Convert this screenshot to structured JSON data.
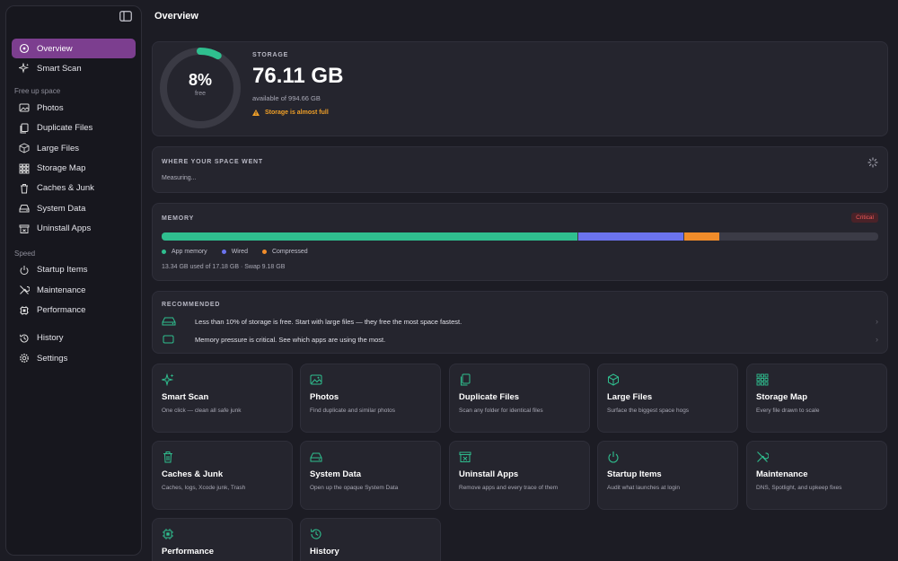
{
  "page": {
    "title": "Overview"
  },
  "sidebar": {
    "items_top": [
      {
        "label": "Overview",
        "icon": "overview-icon"
      },
      {
        "label": "Smart Scan",
        "icon": "sparkle-icon"
      }
    ],
    "section_free": "Free up space",
    "items_free": [
      {
        "label": "Photos"
      },
      {
        "label": "Duplicate Files"
      },
      {
        "label": "Large Files"
      },
      {
        "label": "Storage Map"
      },
      {
        "label": "Caches & Junk"
      },
      {
        "label": "System Data"
      },
      {
        "label": "Uninstall Apps"
      }
    ],
    "section_speed": "Speed",
    "items_speed": [
      {
        "label": "Startup Items"
      },
      {
        "label": "Maintenance"
      },
      {
        "label": "Performance"
      }
    ],
    "items_bottom": [
      {
        "label": "History"
      },
      {
        "label": "Settings"
      }
    ]
  },
  "storage": {
    "label": "STORAGE",
    "percent_free": "8%",
    "percent_free_value": 0.08,
    "free_label": "free",
    "size": "76.11 GB",
    "available": "available of 994.66 GB",
    "warning": "Storage is almost full",
    "accent": "#2fbf8f",
    "warning_color": "#f0a028"
  },
  "space": {
    "label": "WHERE YOUR SPACE WENT",
    "status": "Measuring..."
  },
  "memory": {
    "label": "MEMORY",
    "badge": "Critical",
    "segments": [
      {
        "name": "App memory",
        "fraction": 0.582,
        "color": "#2fbf8f"
      },
      {
        "name": "Wired",
        "fraction": 0.147,
        "color": "#6b73ee"
      },
      {
        "name": "Compressed",
        "fraction": 0.05,
        "color": "#f08c2a"
      }
    ],
    "summary": "13.34 GB used of 17.18 GB · Swap 9.18 GB"
  },
  "recommended": {
    "label": "RECOMMENDED",
    "rows": [
      {
        "text": "Less than 10% of storage is free. Start with large files — they free the most space fastest."
      },
      {
        "text": "Memory pressure is critical. See which apps are using the most."
      }
    ]
  },
  "tiles": [
    {
      "title": "Smart Scan",
      "desc": "One click — clean all safe junk",
      "icon": "sparkle-icon"
    },
    {
      "title": "Photos",
      "desc": "Find duplicate and similar photos",
      "icon": "photos-icon"
    },
    {
      "title": "Duplicate Files",
      "desc": "Scan any folder for identical files",
      "icon": "duplicate-icon"
    },
    {
      "title": "Large Files",
      "desc": "Surface the biggest space hogs",
      "icon": "box-icon"
    },
    {
      "title": "Storage Map",
      "desc": "Every file drawn to scale",
      "icon": "grid-icon"
    },
    {
      "title": "Caches & Junk",
      "desc": "Caches, logs, Xcode junk, Trash",
      "icon": "trash-icon"
    },
    {
      "title": "System Data",
      "desc": "Open up the opaque System Data",
      "icon": "drive-icon"
    },
    {
      "title": "Uninstall Apps",
      "desc": "Remove apps and every trace of them",
      "icon": "uninstall-icon"
    },
    {
      "title": "Startup Items",
      "desc": "Audit what launches at login",
      "icon": "power-icon"
    },
    {
      "title": "Maintenance",
      "desc": "DNS, Spotlight, and upkeep fixes",
      "icon": "tools-icon"
    },
    {
      "title": "Performance",
      "desc": "",
      "icon": "performance-icon"
    },
    {
      "title": "History",
      "desc": "",
      "icon": "history-icon"
    }
  ]
}
